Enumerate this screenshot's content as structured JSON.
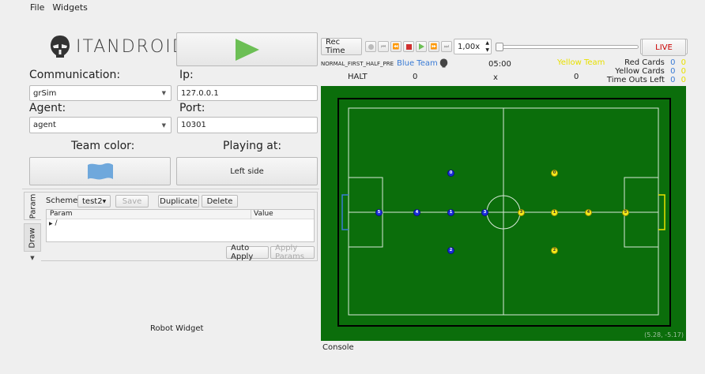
{
  "menu": {
    "file": "File",
    "widgets": "Widgets"
  },
  "logo": {
    "text": "ITANDROIDS"
  },
  "left": {
    "communication_label": "Communication:",
    "ip_label": "Ip:",
    "communication_value": "grSim",
    "ip_value": "127.0.0.1",
    "agent_label": "Agent:",
    "port_label": "Port:",
    "agent_value": "agent",
    "port_value": "10301",
    "team_color_label": "Team color:",
    "playing_at_label": "Playing at:",
    "team_color": "#6fa8dc",
    "side_button": "Left side"
  },
  "params": {
    "tab_param": "Param",
    "tab_draw": "Draw",
    "scheme_label": "Scheme:",
    "scheme_value": "test2",
    "save": "Save",
    "duplicate": "Duplicate",
    "delete": "Delete",
    "col_param": "Param",
    "col_value": "Value",
    "tree_root": "/",
    "auto_apply": "Auto Apply",
    "apply_params": "Apply Params"
  },
  "robot_widget": "Robot Widget",
  "toolbar": {
    "rec_time": "Rec Time",
    "speed": "1,00x",
    "frame": "0",
    "live": "LIVE"
  },
  "referee": {
    "stage": "NORMAL_FIRST_HALF_PRE",
    "blue_team": "Blue Team",
    "time": "05:00",
    "yellow_team": "Yellow Team",
    "red_cards_label": "Red Cards",
    "yellow_cards_label": "Yellow Cards",
    "timeouts_label": "Time Outs Left",
    "red_blue": "0",
    "red_yellow": "0",
    "yc_blue": "0",
    "yc_yellow": "0",
    "to_blue": "0",
    "to_yellow": "0",
    "command": "HALT",
    "blue_score": "0",
    "separator": "x",
    "yellow_score": "0"
  },
  "field": {
    "coords": "(5.28, -5.17)",
    "blue_robots": [
      "0",
      "5",
      "4",
      "1",
      "3",
      "2"
    ],
    "yellow_robots": [
      "0",
      "3",
      "1",
      "4",
      "5",
      "2"
    ]
  },
  "console": "Console",
  "colors": {
    "field_green": "#0b6e0b",
    "blue_team": "#3a7bd5",
    "yellow_team": "#e8e000",
    "live_red": "#cc0000"
  }
}
